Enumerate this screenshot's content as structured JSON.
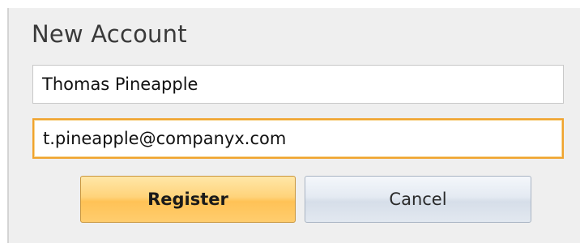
{
  "dialog": {
    "title": "New Account"
  },
  "form": {
    "name_value": "Thomas Pineapple",
    "email_value": "t.pineapple@companyx.com"
  },
  "buttons": {
    "register_label": "Register",
    "cancel_label": "Cancel"
  },
  "colors": {
    "panel_background": "#efefef",
    "focus_border": "#f0a32d",
    "register_gradient_top": "#ffe7a8",
    "register_gradient_bottom": "#ffc256",
    "cancel_gradient_top": "#f4f7fb",
    "cancel_gradient_bottom": "#d6dee9"
  }
}
